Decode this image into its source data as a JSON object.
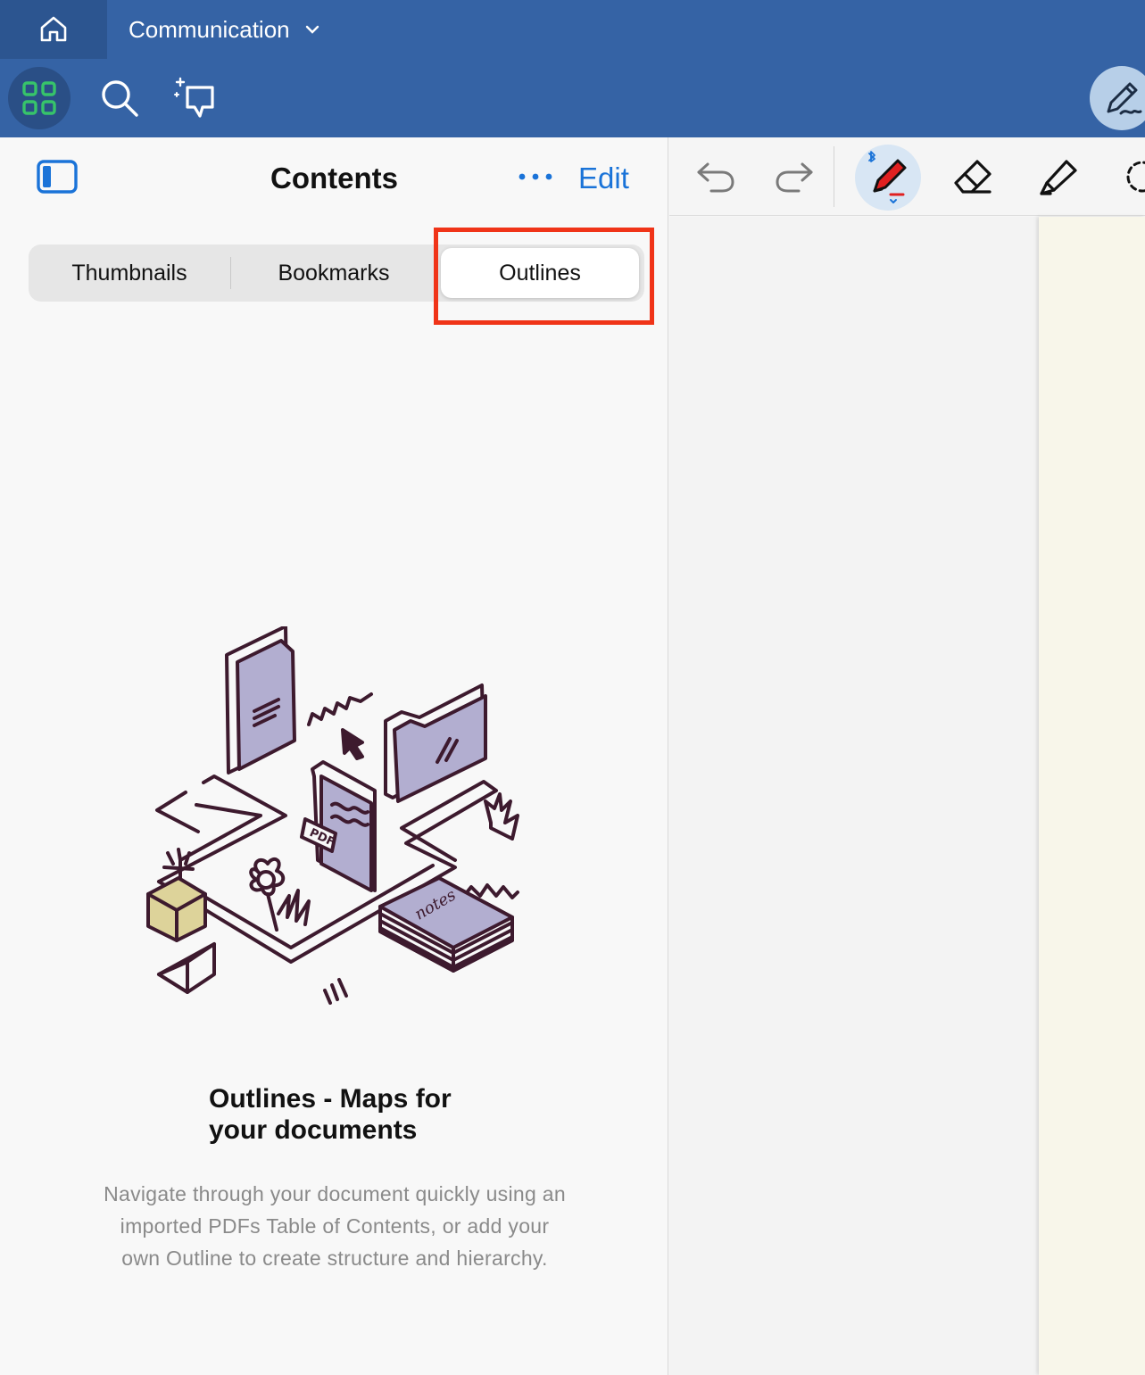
{
  "header": {
    "document_title": "Communication",
    "home_icon": "home-icon",
    "title_chevron_icon": "chevron-down-icon"
  },
  "toolbar": {
    "icons": [
      "grid-icon",
      "search-icon",
      "ai-chat-icon",
      "pen-write-icon"
    ]
  },
  "sidebar": {
    "title": "Contents",
    "edit_label": "Edit",
    "tabs": [
      {
        "label": "Thumbnails",
        "selected": false
      },
      {
        "label": "Bookmarks",
        "selected": false
      },
      {
        "label": "Outlines",
        "selected": true
      }
    ],
    "empty_state": {
      "title": "Outlines - Maps for your documents",
      "description": "Navigate through your document quickly using an imported PDFs Table of Contents, or add your own Outline to create structure and hierarchy.",
      "illustration_labels": [
        "PDF",
        "notes"
      ]
    }
  },
  "doc_toolbar": {
    "tools": [
      "undo-icon",
      "redo-icon",
      "pen-icon",
      "eraser-icon",
      "highlighter-icon",
      "lasso-icon"
    ],
    "active_tool": "pen-icon"
  },
  "colors": {
    "header_bg": "#3563a5",
    "accent": "#1a73d8",
    "highlight_box": "#f03418",
    "pen_red": "#e02020",
    "illustration_ink": "#3d1a2e",
    "illustration_fill": "#b2aed0"
  }
}
